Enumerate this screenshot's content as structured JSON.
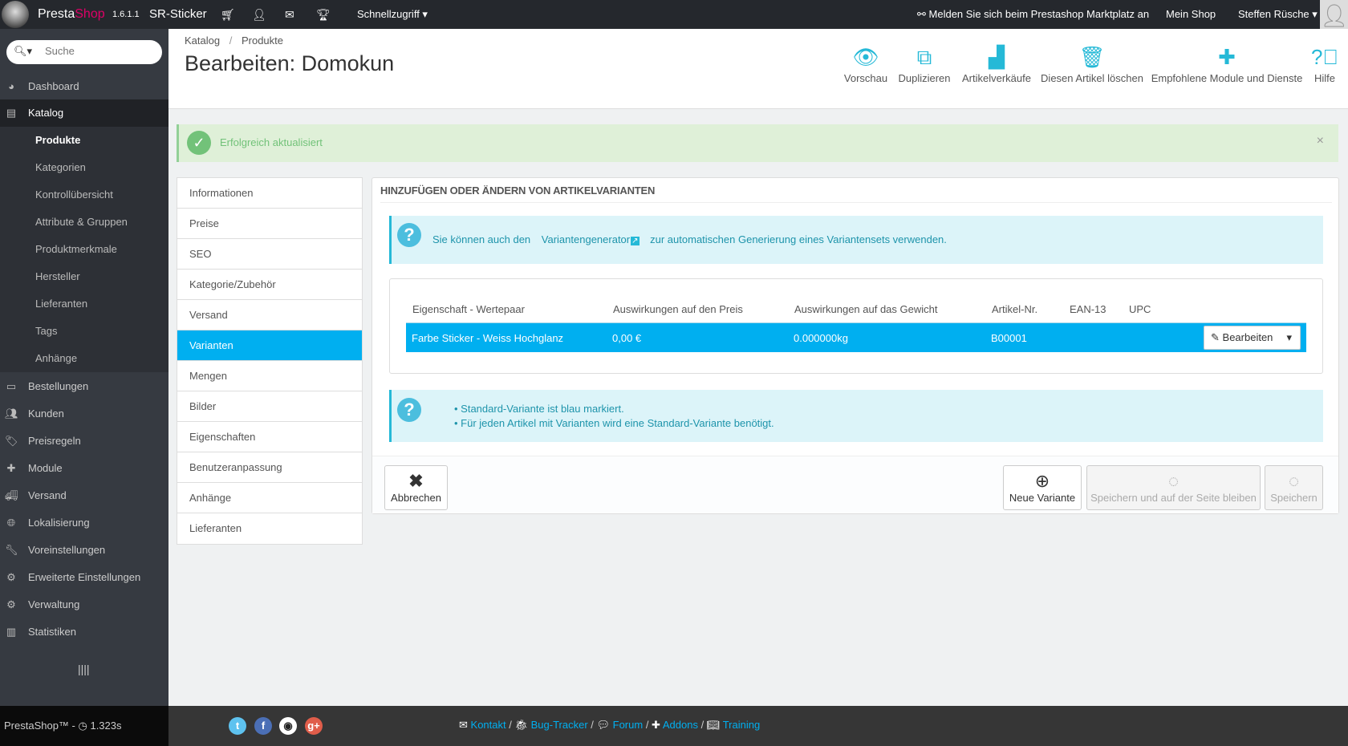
{
  "topbar": {
    "brand_a": "Presta",
    "brand_b": "Shop",
    "version": "1.6.1.1",
    "shop": "SR-Sticker",
    "quick_access": "Schnellzugriff",
    "marketplace": "Melden Sie sich beim Prestashop Marktplatz an",
    "my_shop": "Mein Shop",
    "user": "Steffen Rüsche"
  },
  "sidebar": {
    "search_placeholder": "Suche",
    "items_top": [
      {
        "label": "Dashboard",
        "icon": "dashboard-icon"
      },
      {
        "label": "Katalog",
        "icon": "book-icon"
      }
    ],
    "sub_items": [
      "Produkte",
      "Kategorien",
      "Kontrollübersicht",
      "Attribute & Gruppen",
      "Produktmerkmale",
      "Hersteller",
      "Lieferanten",
      "Tags",
      "Anhänge"
    ],
    "items": [
      {
        "label": "Bestellungen",
        "icon": "credit-card-icon"
      },
      {
        "label": "Kunden",
        "icon": "users-icon"
      },
      {
        "label": "Preisregeln",
        "icon": "tags-icon"
      },
      {
        "label": "Module",
        "icon": "puzzle-icon"
      },
      {
        "label": "Versand",
        "icon": "truck-icon"
      },
      {
        "label": "Lokalisierung",
        "icon": "globe-icon"
      },
      {
        "label": "Voreinstellungen",
        "icon": "wrench-icon"
      },
      {
        "label": "Erweiterte Einstellungen",
        "icon": "cogs-icon"
      },
      {
        "label": "Verwaltung",
        "icon": "gear-icon"
      },
      {
        "label": "Statistiken",
        "icon": "chart-icon"
      }
    ]
  },
  "header": {
    "breadcrumb": [
      "Katalog",
      "Produkte"
    ],
    "title": "Bearbeiten: Domokun",
    "toolbar": [
      "Vorschau",
      "Duplizieren",
      "Artikelverkäufe",
      "Diesen Artikel löschen",
      "Empfohlene Module und Dienste",
      "Hilfe"
    ]
  },
  "alert": {
    "text": "Erfolgreich aktualisiert"
  },
  "tabs": [
    "Informationen",
    "Preise",
    "SEO",
    "Kategorie/Zubehör",
    "Versand",
    "Varianten",
    "Mengen",
    "Bilder",
    "Eigenschaften",
    "Benutzeranpassung",
    "Anhänge",
    "Lieferanten"
  ],
  "panel": {
    "title": "HINZUFÜGEN ODER ÄNDERN VON ARTIKELVARIANTEN",
    "info_pre": "Sie können auch den",
    "info_link": "Variantengenerator",
    "info_post": "zur automatischen Generierung eines Variantensets verwenden.",
    "columns": [
      "Eigenschaft - Wertepaar",
      "Auswirkungen auf den Preis",
      "Auswirkungen auf das Gewicht",
      "Artikel-Nr.",
      "EAN-13",
      "UPC"
    ],
    "row": {
      "attribute": "Farbe Sticker - Weiss Hochglanz",
      "price": "0,00 €",
      "weight": "0.000000kg",
      "reference": "B00001",
      "ean": "",
      "upc": "",
      "edit": "Bearbeiten"
    },
    "notes": [
      "Standard-Variante ist blau markiert.",
      "Für jeden Artikel mit Varianten wird eine Standard-Variante benötigt."
    ],
    "buttons": {
      "cancel": "Abbrechen",
      "new": "Neue Variante",
      "save_stay": "Speichern und auf der Seite bleiben",
      "save": "Speichern"
    }
  },
  "footer": {
    "version": "PrestaShop™ - ",
    "time": "1.323s",
    "links": [
      "Kontakt",
      "Bug-Tracker",
      "Forum",
      "Addons",
      "Training"
    ]
  },
  "colors": {
    "accent": "#00aff0",
    "info": "#25b9d7",
    "success": "#72c279"
  }
}
